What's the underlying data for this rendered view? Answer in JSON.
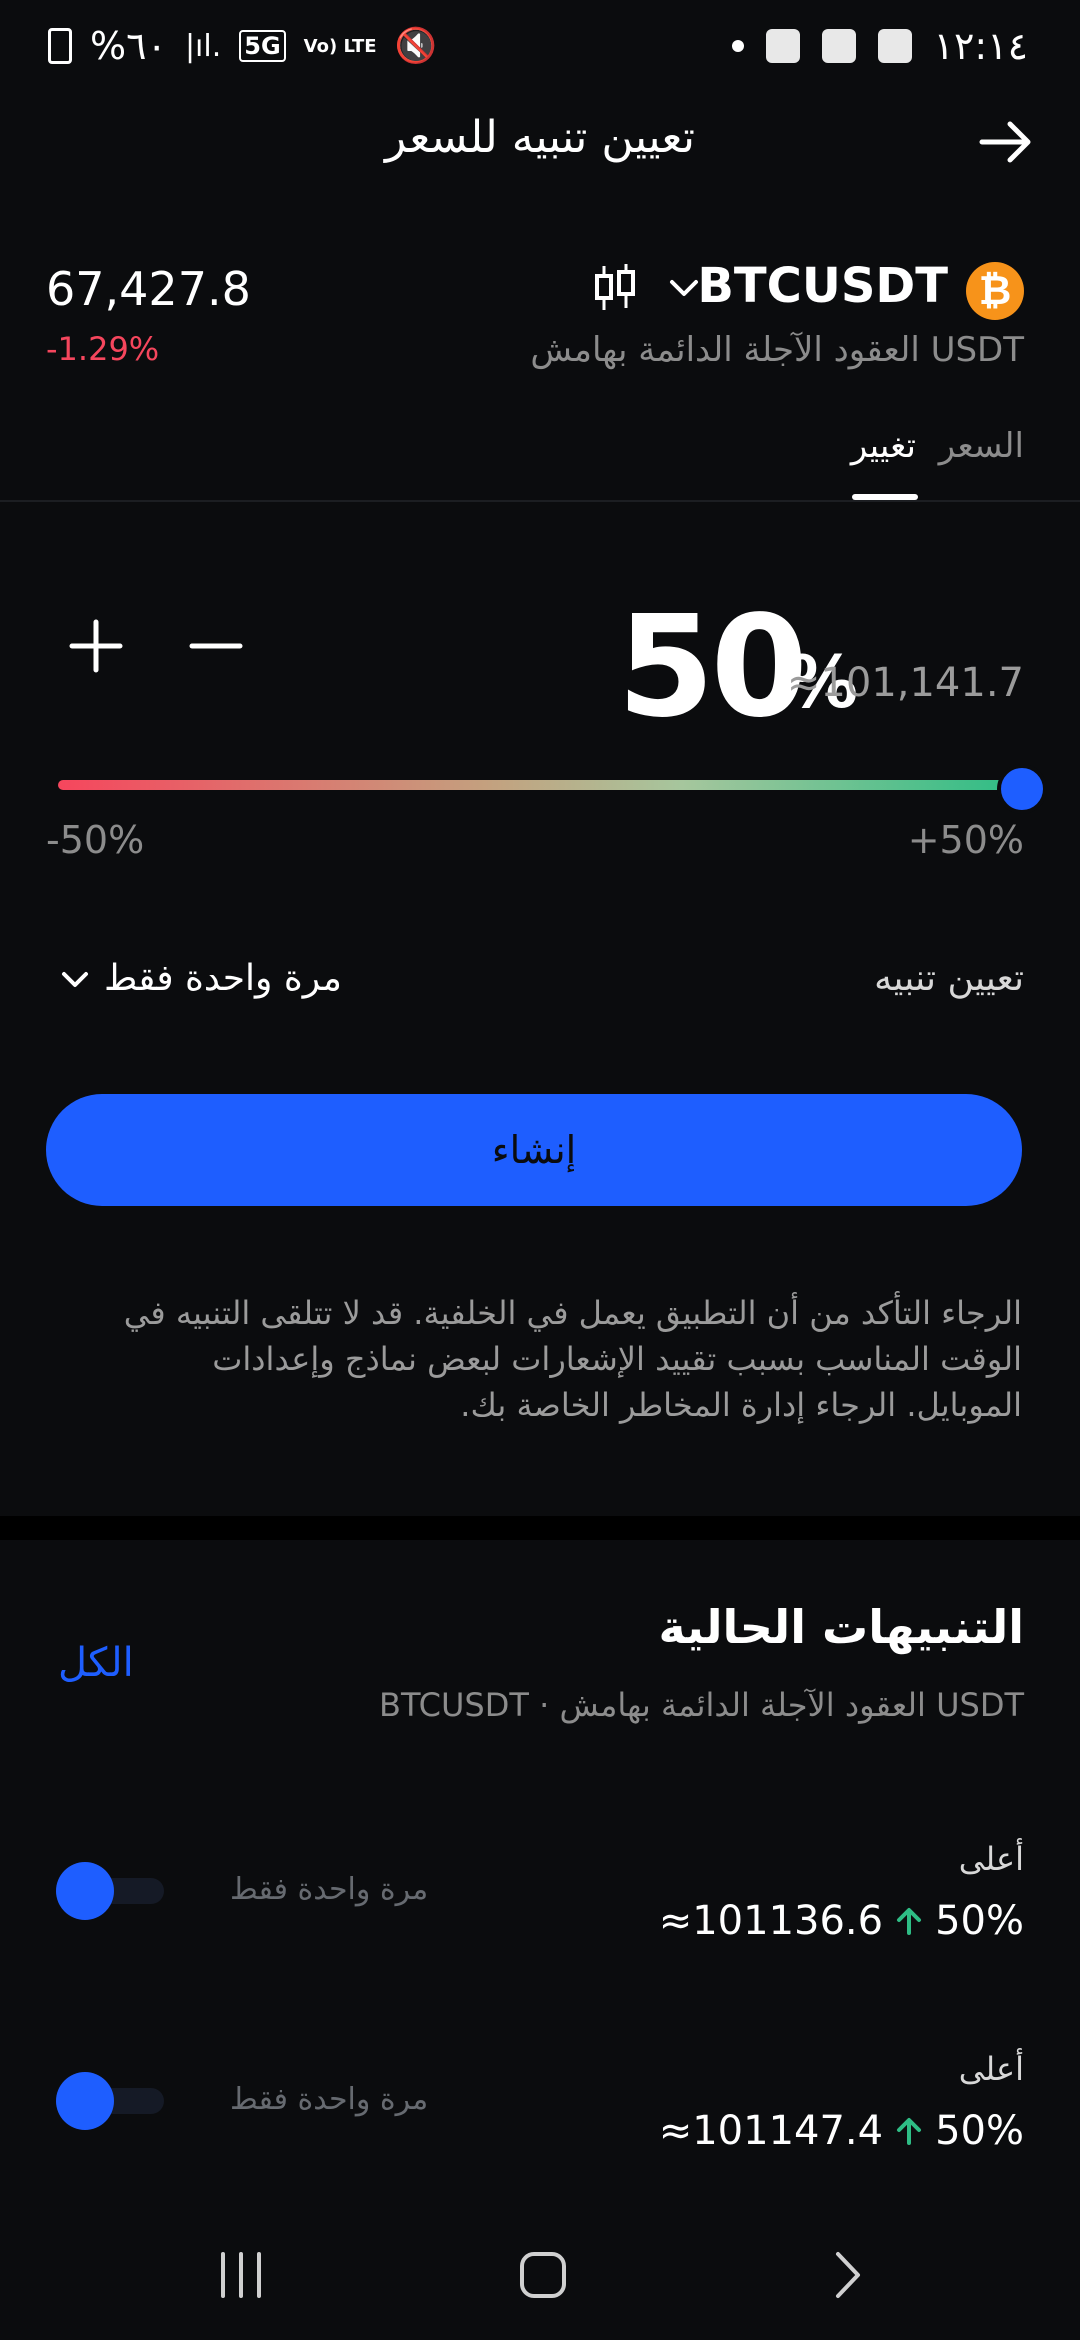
{
  "status_bar": {
    "time": "١٢:١٤",
    "battery": "%٦٠",
    "network": "5G",
    "volte": "Vo) LTE"
  },
  "header": {
    "title": "تعيين تنبيه للسعر",
    "back_icon": "arrow-right-icon"
  },
  "instrument": {
    "symbol": "BTCUSDT",
    "subtitle": "USDT العقود الآجلة الدائمة بهامش",
    "price": "67,427.8",
    "change": "-1.29%",
    "coin_icon": "₿"
  },
  "tabs": [
    {
      "label": "السعر",
      "active": false
    },
    {
      "label": "تغيير",
      "active": true
    }
  ],
  "change_input": {
    "value": "50",
    "unit": "%",
    "approx_price": "≈101,141.7",
    "slider_min": "-50%",
    "slider_max": "+50%",
    "slider_value_percent": 100
  },
  "alert_setting": {
    "label": "تعيين تنبيه",
    "frequency": "مرة واحدة فقط"
  },
  "create_button": "إنشاء",
  "notice": "الرجاء التأكد من أن التطبيق يعمل في الخلفية. قد لا تتلقى التنبيه في الوقت المناسب بسبب تقييد الإشعارات لبعض نماذج وإعدادات الموبايل. الرجاء إدارة المخاطر الخاصة بك.",
  "current_alerts": {
    "title": "التنبيهات الحالية",
    "subtitle": "USDT العقود الآجلة الدائمة بهامش · BTCUSDT",
    "all_link": "الكل",
    "items": [
      {
        "direction": "أعلى",
        "percent": "50%",
        "price": "≈101136.6",
        "frequency": "مرة واحدة فقط"
      },
      {
        "direction": "أعلى",
        "percent": "50%",
        "price": "≈101147.4",
        "frequency": "مرة واحدة فقط"
      }
    ]
  },
  "colors": {
    "accent": "#1e5eff",
    "negative": "#f6465d",
    "positive": "#2ebd85",
    "bitcoin": "#f7931a"
  }
}
